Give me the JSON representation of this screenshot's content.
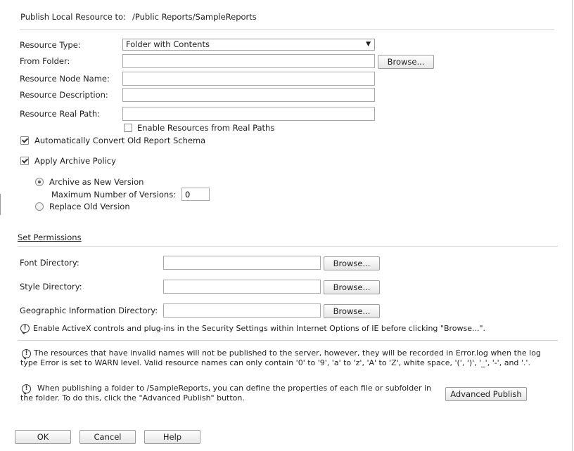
{
  "header": {
    "publish_label": "Publish Local Resource to:",
    "publish_path": "/Public Reports/SampleReports"
  },
  "form": {
    "resource_type_label": "Resource Type:",
    "resource_type_value": "Folder with Contents",
    "from_folder_label": "From Folder:",
    "from_folder_value": "",
    "browse_label": "Browse...",
    "node_name_label": "Resource Node Name:",
    "node_name_value": "",
    "description_label": "Resource Description:",
    "description_value": "",
    "real_path_label": "Resource Real Path:",
    "real_path_value": "",
    "enable_real_paths_label": "Enable Resources from Real Paths",
    "enable_real_paths_checked": false,
    "auto_convert_label": "Automatically Convert Old Report Schema",
    "auto_convert_checked": true,
    "archive_policy_label": "Apply Archive Policy",
    "archive_policy_checked": true,
    "archive_new_label": "Archive as New Version",
    "max_versions_label": "Maximum Number of Versions:",
    "max_versions_value": "0",
    "replace_old_label": "Replace Old Version"
  },
  "permissions": {
    "set_permissions_label": "Set Permissions",
    "font_dir_label": "Font Directory:",
    "font_dir_value": "",
    "style_dir_label": "Style Directory:",
    "style_dir_value": "",
    "geo_dir_label": "Geographic Information Directory:",
    "geo_dir_value": "",
    "browse_label": "Browse...",
    "activex_note": "Enable ActiveX controls and plug-ins in the Security Settings within Internet Options of IE before clicking \"Browse...\"."
  },
  "notes": {
    "invalid_names_note": "The resources that have invalid names will not be published to the server, however, they will be recorded in Error.log when the log type Error is set to WARN level. Valid resource names can only contain '0' to '9', 'a' to 'z', 'A' to 'Z', white space, '(', ')', '_', '-', and '.'.",
    "advanced_note": "When publishing a folder to /SampleReports, you can define the properties of each file or subfolder in the folder. To do this, click the \"Advanced Publish\" button.",
    "advanced_publish_label": "Advanced Publish"
  },
  "footer": {
    "ok_label": "OK",
    "cancel_label": "Cancel",
    "help_label": "Help"
  }
}
